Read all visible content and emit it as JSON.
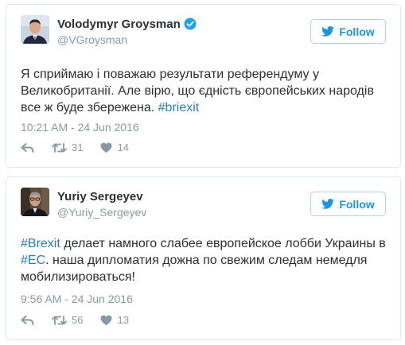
{
  "colors": {
    "follow_blue": "#1b95e0",
    "link_blue": "#2b7bb9",
    "meta_gray": "#8899a6",
    "text_dark": "#292f33",
    "border": "#e1e8ed"
  },
  "tweets": [
    {
      "name": "Volodymyr Groysman",
      "verified": true,
      "handle": "@VGroysman",
      "follow_label": "Follow",
      "text_before": "Я сприймаю і поважаю результати референдуму у Великобританії. Але вірю, що єдність європейських народів все ж буде збережена. ",
      "hashtag": "#briexit",
      "timestamp": "10:21 AM - 24 Jun 2016",
      "reply_icon": "reply-icon",
      "retweet_count": "31",
      "like_count": "14"
    },
    {
      "name": "Yuriy Sergeyev",
      "verified": false,
      "handle": "@Yuriy_Sergeyev",
      "follow_label": "Follow",
      "hashtag_1": "#Brexit",
      "text_part_1": " делает намного слабее европейское лобби Украины в ",
      "hashtag_2": "#EC",
      "text_part_2": ". наша дипломатия дожна по свежим следам немедля мобилизироваться!",
      "timestamp": "9:56 AM - 24 Jun 2016",
      "retweet_count": "56",
      "like_count": "13"
    }
  ]
}
